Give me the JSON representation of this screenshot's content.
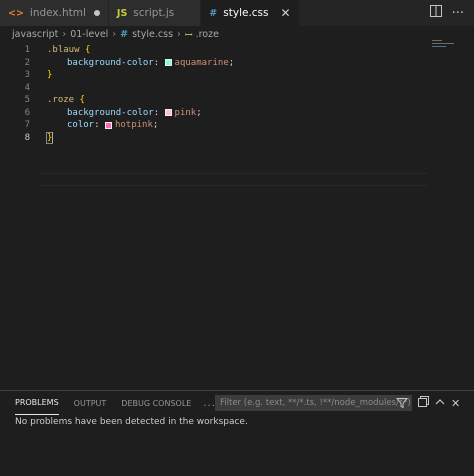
{
  "tabs": [
    {
      "icon": "<>",
      "label": "index.html",
      "state": "modified",
      "icon_color": "#e37933"
    },
    {
      "icon": "JS",
      "label": "script.js",
      "state": "normal",
      "icon_color": "#cbcb41"
    },
    {
      "icon": "#",
      "label": "style.css",
      "state": "active",
      "icon_color": "#519aba"
    }
  ],
  "tab_actions": [
    "split-editor-icon",
    "more-actions-icon"
  ],
  "breadcrumb": {
    "items": [
      "javascript",
      "01-level",
      "style.css",
      ".roze"
    ]
  },
  "editor": {
    "language": "css",
    "current_line": 8,
    "lines": [
      {
        "num": "1",
        "sel": ".blauw",
        "brace": "{"
      },
      {
        "num": "2",
        "prop": "background-color",
        "swatch": "#7fffd4",
        "val": "aquamarine"
      },
      {
        "num": "3",
        "brace": "}"
      },
      {
        "num": "4"
      },
      {
        "num": "5",
        "sel": ".roze",
        "brace": "{"
      },
      {
        "num": "6",
        "prop": "background-color",
        "swatch": "#ffc0cb",
        "val": "pink"
      },
      {
        "num": "7",
        "prop": "color",
        "swatch": "#ff69b4",
        "val": "hotpink"
      },
      {
        "num": "8",
        "brace": "}"
      }
    ]
  },
  "panel": {
    "tabs": [
      "PROBLEMS",
      "OUTPUT",
      "DEBUG CONSOLE",
      "..."
    ],
    "active_tab": "PROBLEMS",
    "filter_placeholder": "Filter (e.g. text, **/*.ts, !**/node_modules/**)",
    "message": "No problems have been detected in the workspace."
  },
  "colors": {
    "editor_bg": "#1e1e1e",
    "selector": "#d7ba7d",
    "property": "#9cdcfe",
    "value": "#ce9178",
    "bracket": "#ffd700"
  }
}
